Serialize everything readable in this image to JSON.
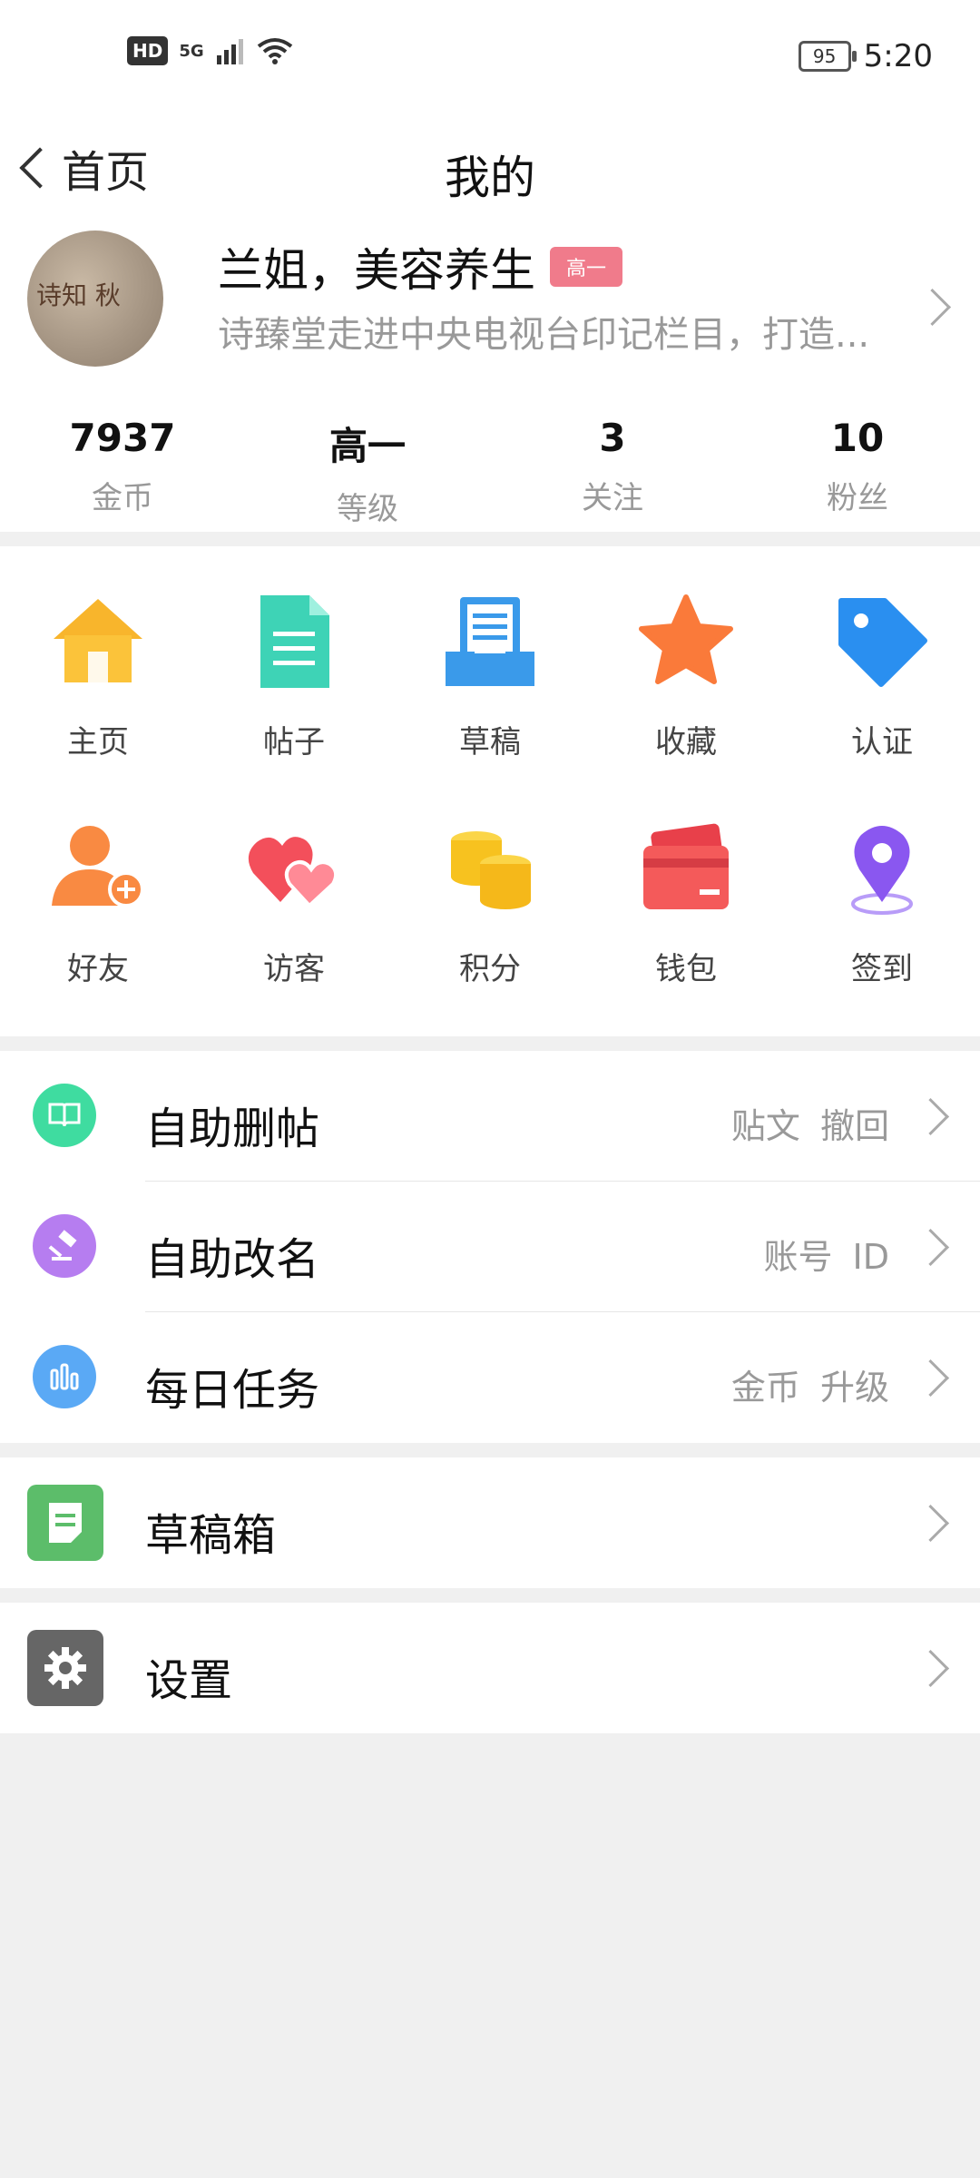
{
  "status": {
    "hd": "HD",
    "network": "5G",
    "battery": "95",
    "time": "5:20"
  },
  "nav": {
    "back_label": "首页",
    "title": "我的"
  },
  "profile": {
    "name": "兰姐，美容养生",
    "level_badge": "高一",
    "description": "诗臻堂走进中央电视台印记栏目，打造...",
    "avatar_text": "诗知 秋"
  },
  "stats": [
    {
      "value": "7937",
      "label": "金币"
    },
    {
      "value": "高一",
      "label": "等级"
    },
    {
      "value": "3",
      "label": "关注"
    },
    {
      "value": "10",
      "label": "粉丝"
    }
  ],
  "grid": [
    {
      "label": "主页",
      "icon": "home-icon",
      "color": "#f8b52c"
    },
    {
      "label": "帖子",
      "icon": "document-icon",
      "color": "#3ed3b6"
    },
    {
      "label": "草稿",
      "icon": "draft-tray-icon",
      "color": "#3a9aea"
    },
    {
      "label": "收藏",
      "icon": "star-icon",
      "color": "#fa7a3a"
    },
    {
      "label": "认证",
      "icon": "tag-icon",
      "color": "#2a8ff0"
    },
    {
      "label": "好友",
      "icon": "add-friend-icon",
      "color": "#f98a42"
    },
    {
      "label": "访客",
      "icon": "hearts-icon",
      "color": "#f34f5b"
    },
    {
      "label": "积分",
      "icon": "coins-icon",
      "color": "#f7c21f"
    },
    {
      "label": "钱包",
      "icon": "wallet-card-icon",
      "color": "#f45a5a"
    },
    {
      "label": "签到",
      "icon": "location-pin-icon",
      "color": "#8a57f0"
    }
  ],
  "list1": [
    {
      "title": "自助删帖",
      "extra": "贴文 撤回",
      "icon": "book-icon",
      "color": "#3fdca0"
    },
    {
      "title": "自助改名",
      "extra": "账号 ID",
      "icon": "gavel-icon",
      "color": "#b67df0"
    },
    {
      "title": "每日任务",
      "extra": "金币 升级",
      "icon": "bar-chart-icon",
      "color": "#5aa9f5"
    }
  ],
  "list2": [
    {
      "title": "草稿箱",
      "icon": "draft-box-icon",
      "color": "#5cbd6a"
    },
    {
      "title": "设置",
      "icon": "gear-icon",
      "color": "#666666"
    }
  ]
}
